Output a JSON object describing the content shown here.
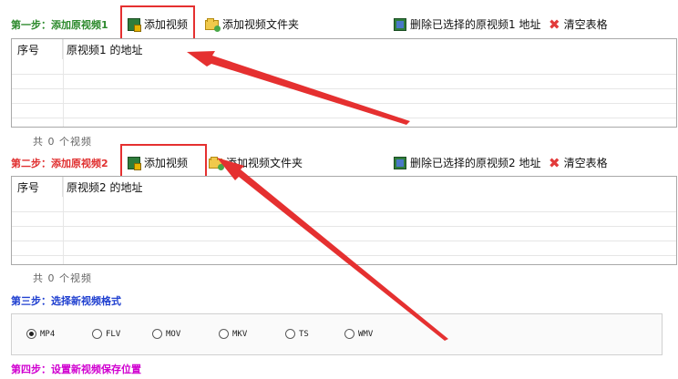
{
  "step1": {
    "label": "第一步：添加原视频1",
    "add_video": "添加视频",
    "add_folder": "添加视频文件夹",
    "delete_selected": "删除已选择的原视频1 地址",
    "clear_table": "清空表格",
    "table": {
      "col_index": "序号",
      "col_address": "原视频1 的地址",
      "rows": []
    },
    "count_text": "共 0 个视频"
  },
  "step2": {
    "label": "第二步：添加原视频2",
    "add_video": "添加视频",
    "add_folder": "添加视频文件夹",
    "delete_selected": "删除已选择的原视频2 地址",
    "clear_table": "清空表格",
    "table": {
      "col_index": "序号",
      "col_address": "原视频2 的地址",
      "rows": []
    },
    "count_text": "共 0 个视频"
  },
  "step3": {
    "label": "第三步：选择新视频格式",
    "formats": [
      "MP4",
      "FLV",
      "MOV",
      "MKV",
      "TS",
      "WMV"
    ],
    "selected": "MP4"
  },
  "step4": {
    "label": "第四步：设置新视频保存位置"
  },
  "colors": {
    "step1": "#2d8a2d",
    "step2": "#e03030",
    "step3": "#2040d0",
    "step4": "#d000d0",
    "highlight": "#e53030"
  }
}
